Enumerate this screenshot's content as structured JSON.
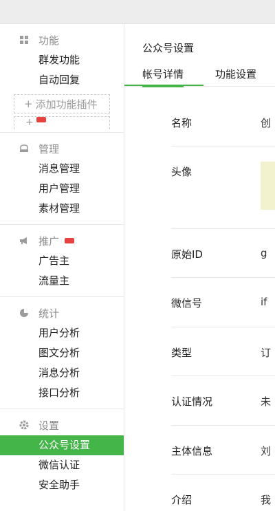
{
  "sidebar": {
    "sections": [
      {
        "title": "功能",
        "icon": "grid-icon",
        "items": [
          "群发功能",
          "自动回复"
        ],
        "plugin_add": "添加功能插件",
        "plugin_plus": "+"
      },
      {
        "title": "管理",
        "icon": "chat-icon",
        "items": [
          "消息管理",
          "用户管理",
          "素材管理"
        ]
      },
      {
        "title": "推广",
        "icon": "megaphone-icon",
        "items": [
          "广告主",
          "流量主"
        ]
      },
      {
        "title": "统计",
        "icon": "pie-chart-icon",
        "items": [
          "用户分析",
          "图文分析",
          "消息分析",
          "接口分析"
        ]
      },
      {
        "title": "设置",
        "icon": "gear-icon",
        "items": [
          "公众号设置",
          "微信认证",
          "安全助手"
        ]
      }
    ]
  },
  "main": {
    "title": "公众号设置",
    "tabs": [
      "帐号详情",
      "功能设置"
    ],
    "rows": [
      {
        "label": "名称",
        "value": "创"
      },
      {
        "label": "头像",
        "value": ""
      },
      {
        "label": "原始ID",
        "value": "g"
      },
      {
        "label": "微信号",
        "value": "if"
      },
      {
        "label": "类型",
        "value": "订"
      },
      {
        "label": "认证情况",
        "value": "未"
      },
      {
        "label": "主体信息",
        "value": "刘"
      },
      {
        "label": "介绍",
        "value": "我"
      }
    ]
  },
  "colors": {
    "accent": "#44b549",
    "badge": "#e64340",
    "avatar_bg": "#f2f2cf"
  }
}
